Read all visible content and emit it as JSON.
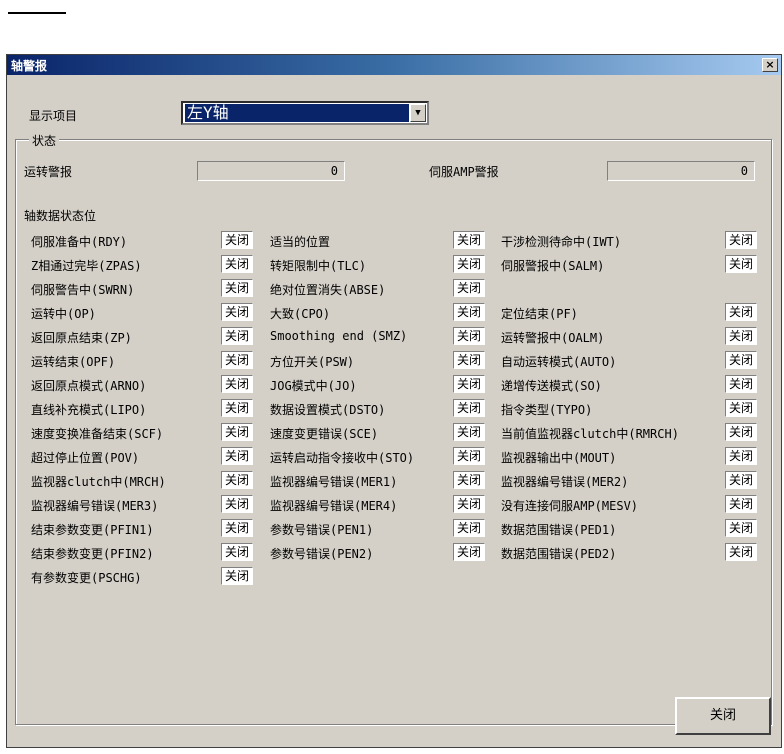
{
  "window": {
    "title": "轴警报",
    "close_glyph": "×"
  },
  "display": {
    "label": "显示项目",
    "selected": "左Y轴"
  },
  "status_group": {
    "label": "状态",
    "run_alarm_label": "运转警报",
    "run_alarm_value": "0",
    "servo_alarm_label": "伺服AMP警报",
    "servo_alarm_value": "0"
  },
  "axis_bits": {
    "label": "轴数据状态位",
    "rows": [
      [
        {
          "label": "伺服准备中(RDY)",
          "value": "关闭"
        },
        {
          "label": "适当的位置",
          "value": "关闭"
        },
        {
          "label": "干涉检测待命中(IWT)",
          "value": "关闭"
        }
      ],
      [
        {
          "label": "Z相通过完毕(ZPAS)",
          "value": "关闭"
        },
        {
          "label": "转矩限制中(TLC)",
          "value": "关闭"
        },
        {
          "label": "伺服警报中(SALM)",
          "value": "关闭"
        }
      ],
      [
        {
          "label": "伺服警告中(SWRN)",
          "value": "关闭"
        },
        {
          "label": "绝对位置消失(ABSE)",
          "value": "关闭"
        },
        null
      ],
      [
        {
          "label": "运转中(OP)",
          "value": "关闭"
        },
        {
          "label": "大致(CPO)",
          "value": "关闭"
        },
        {
          "label": "定位结束(PF)",
          "value": "关闭"
        }
      ],
      [
        {
          "label": "返回原点结束(ZP)",
          "value": "关闭"
        },
        {
          "label": "Smoothing end (SMZ)",
          "value": "关闭"
        },
        {
          "label": "运转警报中(OALM)",
          "value": "关闭"
        }
      ],
      [
        {
          "label": "运转结束(OPF)",
          "value": "关闭"
        },
        {
          "label": "方位开关(PSW)",
          "value": "关闭"
        },
        {
          "label": "自动运转模式(AUTO)",
          "value": "关闭"
        }
      ],
      [
        {
          "label": "返回原点模式(ARNO)",
          "value": "关闭"
        },
        {
          "label": "JOG模式中(JO)",
          "value": "关闭"
        },
        {
          "label": "递增传送模式(SO)",
          "value": "关闭"
        }
      ],
      [
        {
          "label": "直线补充模式(LIPO)",
          "value": "关闭"
        },
        {
          "label": "数据设置模式(DSTO)",
          "value": "关闭"
        },
        {
          "label": "指令类型(TYPO)",
          "value": "关闭"
        }
      ],
      [
        {
          "label": "速度变换准备结束(SCF)",
          "value": "关闭"
        },
        {
          "label": "速度变更错误(SCE)",
          "value": "关闭"
        },
        {
          "label": "当前值监视器clutch中(RMRCH)",
          "value": "关闭"
        }
      ],
      [
        {
          "label": "超过停止位置(POV)",
          "value": "关闭"
        },
        {
          "label": "运转启动指令接收中(STO)",
          "value": "关闭"
        },
        {
          "label": "监视器输出中(MOUT)",
          "value": "关闭"
        }
      ],
      [
        {
          "label": "监视器clutch中(MRCH)",
          "value": "关闭"
        },
        {
          "label": "监视器编号错误(MER1)",
          "value": "关闭"
        },
        {
          "label": "监视器编号错误(MER2)",
          "value": "关闭"
        }
      ],
      [
        {
          "label": "监视器编号错误(MER3)",
          "value": "关闭"
        },
        {
          "label": "监视器编号错误(MER4)",
          "value": "关闭"
        },
        {
          "label": "没有连接伺服AMP(MESV)",
          "value": "关闭"
        }
      ],
      [
        {
          "label": "结束参数变更(PFIN1)",
          "value": "关闭"
        },
        {
          "label": "参数号错误(PEN1)",
          "value": "关闭"
        },
        {
          "label": "数据范围错误(PED1)",
          "value": "关闭"
        }
      ],
      [
        {
          "label": "结束参数变更(PFIN2)",
          "value": "关闭"
        },
        {
          "label": "参数号错误(PEN2)",
          "value": "关闭"
        },
        {
          "label": "数据范围错误(PED2)",
          "value": "关闭"
        }
      ],
      [
        {
          "label": "有参数变更(PSCHG)",
          "value": "关闭"
        },
        null,
        null
      ]
    ]
  },
  "footer": {
    "close_label": "关闭"
  }
}
